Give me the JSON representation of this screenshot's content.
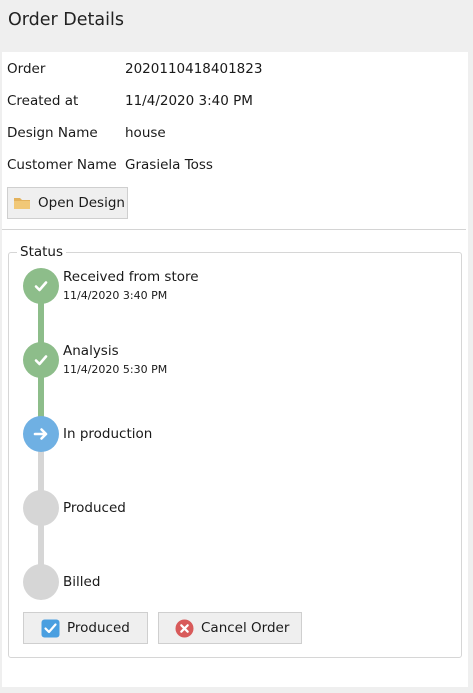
{
  "header": {
    "title": "Order Details"
  },
  "order": {
    "fields": [
      {
        "label": "Order",
        "value": "2020110418401823"
      },
      {
        "label": "Created at",
        "value": "11/4/2020 3:40 PM"
      },
      {
        "label": "Design Name",
        "value": "house"
      },
      {
        "label": "Customer Name",
        "value": "Grasiela Toss"
      }
    ],
    "open_design_label": "Open Design"
  },
  "status": {
    "title": "Status",
    "steps": [
      {
        "label": "Received from store",
        "time": "11/4/2020 3:40 PM",
        "state": "done",
        "icon": "check-icon"
      },
      {
        "label": "Analysis",
        "time": "11/4/2020 5:30 PM",
        "state": "done",
        "icon": "check-icon"
      },
      {
        "label": "In production",
        "time": "",
        "state": "current",
        "icon": "arrow-right-icon"
      },
      {
        "label": "Produced",
        "time": "",
        "state": "pending",
        "icon": ""
      },
      {
        "label": "Billed",
        "time": "",
        "state": "pending",
        "icon": ""
      }
    ],
    "actions": {
      "produced_label": "Produced",
      "cancel_label": "Cancel Order"
    }
  },
  "colors": {
    "done": "#8dbd8a",
    "current": "#6fb0e3",
    "pending": "#d6d6d6",
    "cancel": "#d85a5a",
    "produced_check": "#4a9fe0",
    "folder": "#e3b25c"
  }
}
